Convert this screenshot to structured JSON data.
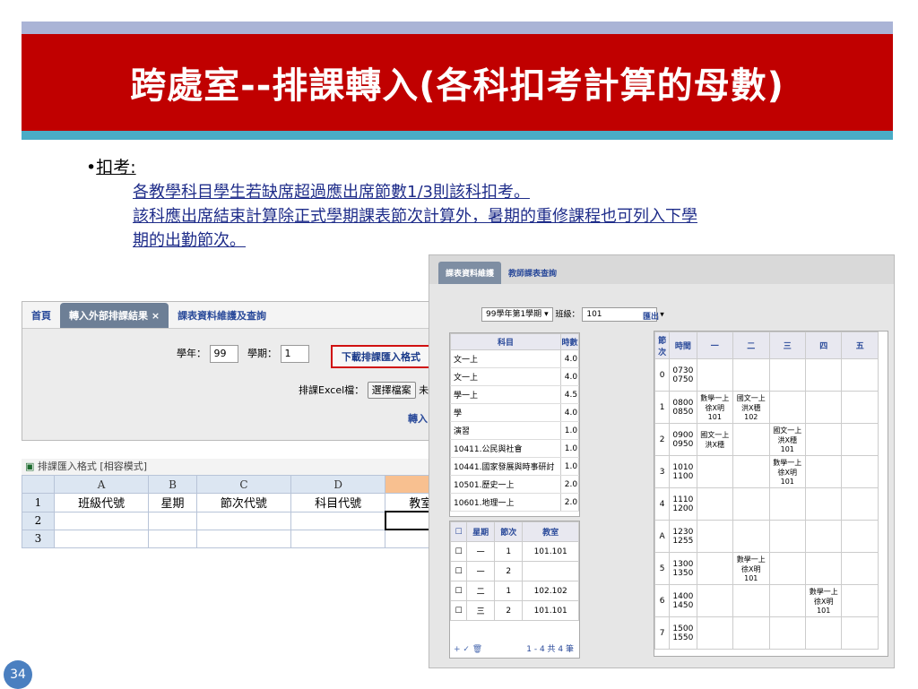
{
  "slide": {
    "title": "跨處室--排課轉入(各科扣考計算的母數)",
    "bullet_head": "扣考:",
    "lines": [
      "各教學科目學生若缺席超過應出席節數1/3則該科扣考。",
      "該科應出席結束計算除正式學期課表節次計算外，暑期的重修課程也可列入下學",
      "期的出勤節次。"
    ],
    "page_number": "34"
  },
  "screen1": {
    "tabs": [
      "首頁",
      "轉入外部排課結果",
      "課表資料維護及查詢"
    ],
    "tab_close": "×",
    "year_label": "學年：",
    "year_value": "99",
    "term_label": "學期：",
    "term_value": "1",
    "download_btn": "下載排課匯入格式",
    "excel_label": "排課Excel檔：",
    "choose_btn": "選擇檔案",
    "no_file": "未選擇檔案",
    "import_btn": "轉入"
  },
  "excel": {
    "title": "排課匯入格式 [相容模式]",
    "cols": [
      "A",
      "B",
      "C",
      "D",
      "E"
    ],
    "rows": [
      "1",
      "2",
      "3"
    ],
    "headers": [
      "班級代號",
      "星期",
      "節次代號",
      "科目代號",
      "教室代號"
    ]
  },
  "screen2": {
    "tabs": [
      "課表資料維護",
      "教師課表查詢"
    ],
    "term_select": "99學年第1學期",
    "class_label": "班級：",
    "class_value": "101",
    "export_btn": "匯出",
    "subj_header": [
      "科目",
      "時數"
    ],
    "subjects": [
      {
        "name": "文一上",
        "hours": "4.0"
      },
      {
        "name": "文一上",
        "hours": "4.0"
      },
      {
        "name": "學一上",
        "hours": "4.5"
      },
      {
        "name": "學",
        "hours": "4.0"
      },
      {
        "name": "演習",
        "hours": "1.0"
      },
      {
        "name": "10411.公民與社會",
        "hours": "1.0"
      },
      {
        "name": "10441.國家發展與時事研討",
        "hours": "1.0"
      },
      {
        "name": "10501.歷史一上",
        "hours": "2.0"
      },
      {
        "name": "10601.地理一上",
        "hours": "2.0"
      }
    ],
    "detail_header": [
      "星期",
      "節次",
      "教室"
    ],
    "details": [
      {
        "day": "一",
        "period": "1",
        "room": "101.101"
      },
      {
        "day": "一",
        "period": "2",
        "room": ""
      },
      {
        "day": "二",
        "period": "1",
        "room": "102.102"
      },
      {
        "day": "三",
        "period": "2",
        "room": "101.101"
      }
    ],
    "pager": "1 - 4 共 4 筆",
    "pager_icons": "+ ✓ 🗑",
    "tt_header": [
      "節次",
      "時間",
      "一",
      "二",
      "三",
      "四",
      "五"
    ],
    "tt_rows": [
      {
        "p": "0",
        "t": "0730\n0750",
        "c": [
          "",
          "",
          "",
          "",
          ""
        ]
      },
      {
        "p": "1",
        "t": "0800\n0850",
        "c": [
          "數學一上\n徐X明\n101",
          "國文一上\n洪X穗\n102",
          "",
          "",
          ""
        ]
      },
      {
        "p": "2",
        "t": "0900\n0950",
        "c": [
          "國文一上\n洪X穗",
          "",
          "國文一上\n洪X穗\n101",
          "",
          ""
        ]
      },
      {
        "p": "3",
        "t": "1010\n1100",
        "c": [
          "",
          "",
          "數學一上\n徐X明\n101",
          "",
          ""
        ]
      },
      {
        "p": "4",
        "t": "1110\n1200",
        "c": [
          "",
          "",
          "",
          "",
          ""
        ]
      },
      {
        "p": "A",
        "t": "1230\n1255",
        "c": [
          "",
          "",
          "",
          "",
          ""
        ]
      },
      {
        "p": "5",
        "t": "1300\n1350",
        "c": [
          "",
          "數學一上\n徐X明\n101",
          "",
          "",
          ""
        ]
      },
      {
        "p": "6",
        "t": "1400\n1450",
        "c": [
          "",
          "",
          "",
          "數學一上\n徐X明\n101",
          ""
        ]
      },
      {
        "p": "7",
        "t": "1500\n1550",
        "c": [
          "",
          "",
          "",
          "",
          ""
        ]
      }
    ]
  }
}
